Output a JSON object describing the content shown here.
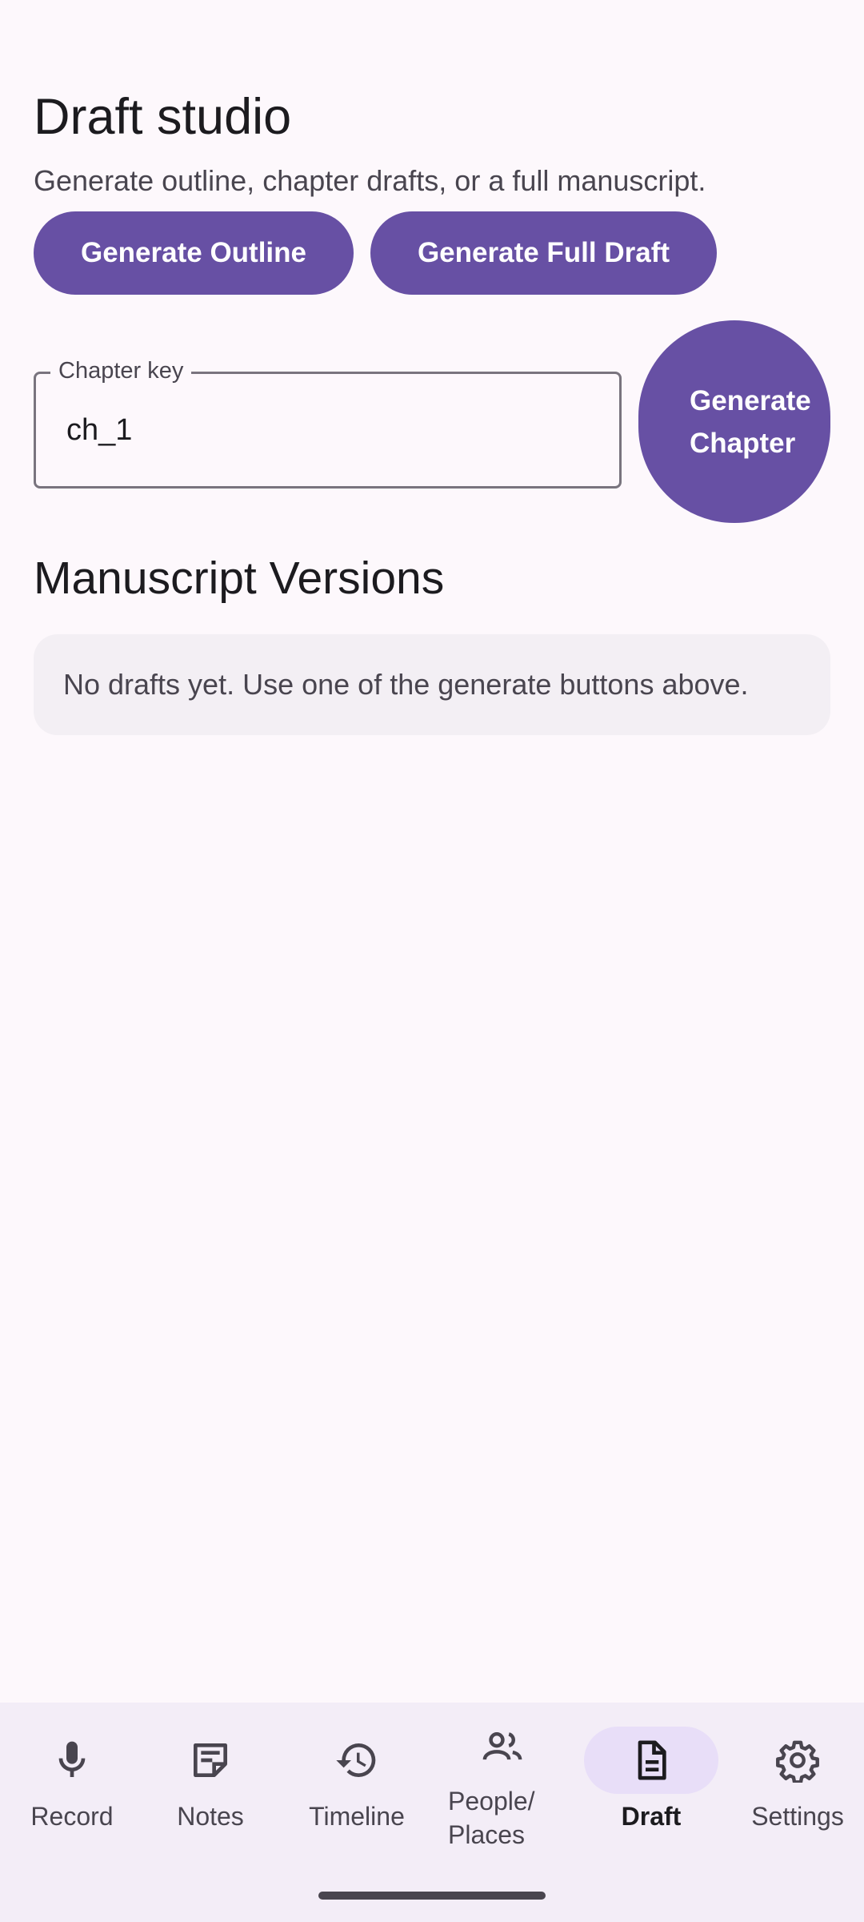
{
  "header": {
    "title": "Draft studio",
    "subtitle": "Generate outline, chapter drafts, or a full manuscript."
  },
  "actions": {
    "generate_outline_label": "Generate Outline",
    "generate_full_draft_label": "Generate Full Draft",
    "generate_chapter_label": "Generate Chapter"
  },
  "chapter_field": {
    "label": "Chapter key",
    "value": "ch_1"
  },
  "versions": {
    "title": "Manuscript Versions",
    "empty_message": "No drafts yet. Use one of the generate buttons above."
  },
  "bottom_nav": {
    "selected": "Draft",
    "items": [
      {
        "label": "Record",
        "icon": "mic-icon"
      },
      {
        "label": "Notes",
        "icon": "note-icon"
      },
      {
        "label": "Timeline",
        "icon": "history-icon"
      },
      {
        "label": "People/\nPlaces",
        "icon": "people-icon"
      },
      {
        "label": "Draft",
        "icon": "document-icon"
      },
      {
        "label": "Settings",
        "icon": "gear-icon"
      }
    ]
  },
  "colors": {
    "primary": "#6750A4",
    "background": "#FDF8FC",
    "nav_background": "#F3EDF7",
    "nav_active_indicator": "#E8DEF8",
    "card_background": "#F3EFF4"
  }
}
